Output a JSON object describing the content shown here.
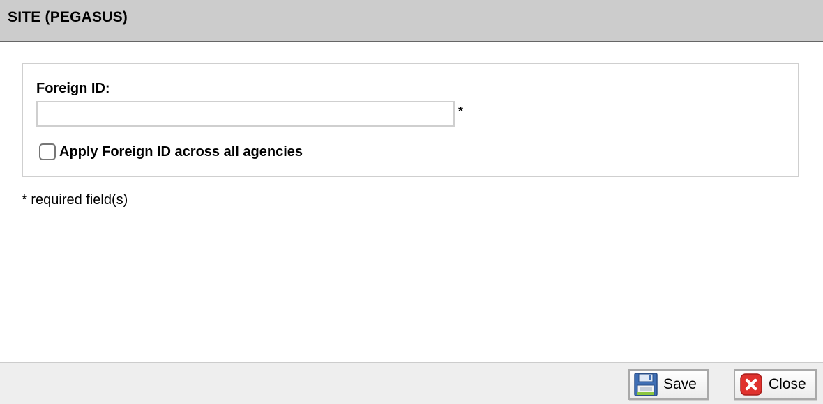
{
  "dialog": {
    "title": "SITE (PEGASUS)"
  },
  "form": {
    "foreign_id_label": "Foreign ID:",
    "foreign_id_value": "",
    "required_marker": "*",
    "apply_checkbox_label": "Apply Foreign ID across all agencies",
    "apply_checkbox_checked": false
  },
  "note": {
    "required_text": "* required field(s)"
  },
  "footer": {
    "save_label": "Save",
    "close_label": "Close",
    "save_icon": "floppy-disk-icon",
    "close_icon": "close-x-icon"
  },
  "colors": {
    "title_bar_bg": "#cccccc",
    "footer_bg": "#eeeeee",
    "close_icon_red": "#e0322e",
    "save_icon_blue": "#3f6fb5"
  }
}
